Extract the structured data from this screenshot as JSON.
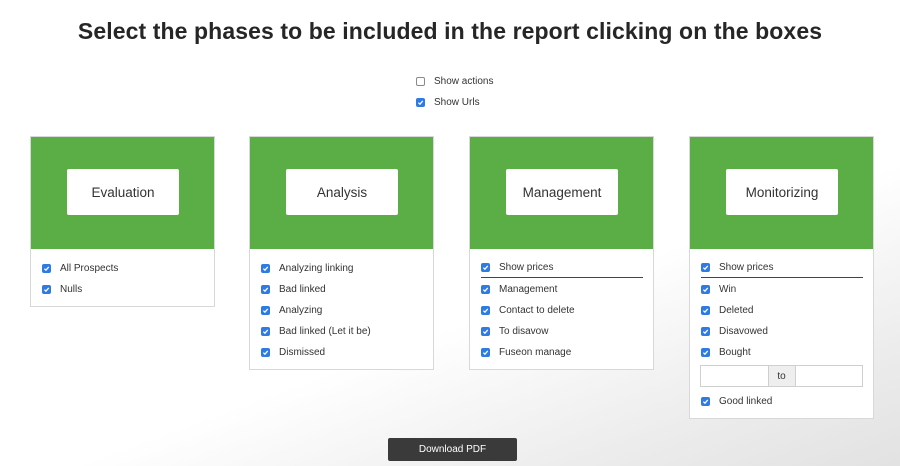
{
  "page": {
    "title": "Select the phases to be included in the report clicking on the boxes"
  },
  "options": [
    {
      "label": "Show actions",
      "checked": false
    },
    {
      "label": "Show Urls",
      "checked": true
    }
  ],
  "colors": {
    "card_header": "#5bad45",
    "checkbox_checked": "#2f7be1",
    "download_button": "#3a3a3a"
  },
  "cards": [
    {
      "name": "Evaluation",
      "items": [
        {
          "label": "All Prospects",
          "checked": true
        },
        {
          "label": "Nulls",
          "checked": true
        }
      ]
    },
    {
      "name": "Analysis",
      "items": [
        {
          "label": "Analyzing linking",
          "checked": true
        },
        {
          "label": "Bad linked",
          "checked": true
        },
        {
          "label": "Analyzing",
          "checked": true
        },
        {
          "label": "Bad linked (Let it be)",
          "checked": true
        },
        {
          "label": "Dismissed",
          "checked": true
        }
      ]
    },
    {
      "name": "Management",
      "show_prices": {
        "label": "Show prices",
        "checked": true
      },
      "items": [
        {
          "label": "Management",
          "checked": true
        },
        {
          "label": "Contact to delete",
          "checked": true
        },
        {
          "label": "To disavow",
          "checked": true
        },
        {
          "label": "Fuseon manage",
          "checked": true
        }
      ]
    },
    {
      "name": "Monitorizing",
      "show_prices": {
        "label": "Show prices",
        "checked": true
      },
      "items": [
        {
          "label": "Win",
          "checked": true
        },
        {
          "label": "Deleted",
          "checked": true
        },
        {
          "label": "Disavowed",
          "checked": true
        },
        {
          "label": "Bought",
          "checked": true
        }
      ],
      "range": {
        "from_value": "",
        "to_label": "to",
        "to_value": ""
      },
      "after_items": [
        {
          "label": "Good linked",
          "checked": true
        }
      ]
    }
  ],
  "download": {
    "label": "Download PDF"
  }
}
